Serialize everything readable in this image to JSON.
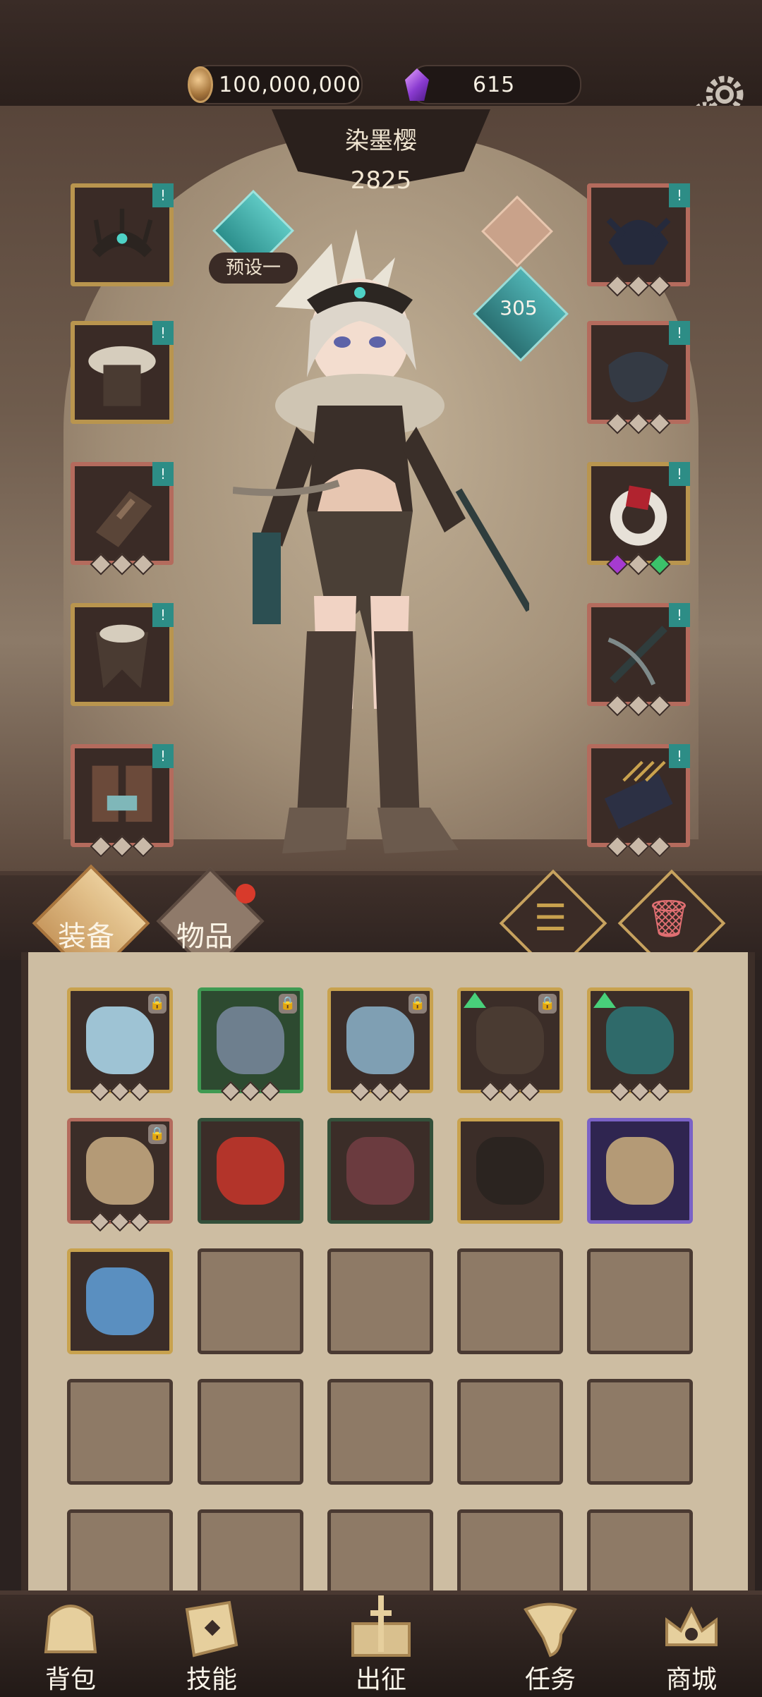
{
  "top": {
    "gold": "100,000,000",
    "gems": "615"
  },
  "hero": {
    "name": "染墨樱",
    "power": "2825",
    "preset_label": "预设一",
    "level": "305",
    "left_slots": [
      {
        "item": "crown",
        "frame": "gold",
        "tag": "!"
      },
      {
        "item": "fur-armor",
        "frame": "gold",
        "tag": "!"
      },
      {
        "item": "bracer",
        "frame": "red",
        "tag": "!"
      },
      {
        "item": "fur-skirt",
        "frame": "gold",
        "tag": "!"
      },
      {
        "item": "boots",
        "frame": "red",
        "tag": "!"
      }
    ],
    "right_slots": [
      {
        "item": "dark-helm",
        "frame": "red",
        "tag": "!"
      },
      {
        "item": "gauntlet",
        "frame": "red",
        "tag": "!"
      },
      {
        "item": "ring-ruby",
        "frame": "gold",
        "tag": "!"
      },
      {
        "item": "crossbow",
        "frame": "red",
        "tag": "!"
      },
      {
        "item": "quiver",
        "frame": "red",
        "tag": "!"
      }
    ]
  },
  "inventory": {
    "tabs": {
      "equip": "装备",
      "items": "物品"
    },
    "sort_glyph": "☰",
    "trash_glyph": "🗑",
    "items": [
      {
        "frame": "gold",
        "lock": true,
        "up": false,
        "art": "crossbow-ice"
      },
      {
        "frame": "green",
        "lock": true,
        "up": false,
        "art": "gauntlet-orb"
      },
      {
        "frame": "gold",
        "lock": true,
        "up": false,
        "art": "armor-ice"
      },
      {
        "frame": "gold",
        "lock": true,
        "up": true,
        "art": "skirt-spiked"
      },
      {
        "frame": "gold",
        "lock": false,
        "up": true,
        "art": "teal-pants"
      },
      {
        "frame": "red",
        "lock": true,
        "up": false,
        "art": "owl-amulet"
      },
      {
        "frame": "dgreen",
        "lock": false,
        "up": false,
        "art": "red-hood"
      },
      {
        "frame": "dgreen",
        "lock": false,
        "up": false,
        "art": "leather-boots"
      },
      {
        "frame": "gold",
        "lock": false,
        "up": false,
        "art": "crown"
      },
      {
        "frame": "purple",
        "lock": false,
        "up": false,
        "art": "owl-amulet"
      },
      {
        "frame": "gold",
        "lock": false,
        "up": false,
        "art": "eye-pendant"
      }
    ]
  },
  "nav": {
    "items": [
      {
        "label": "背包",
        "icon": "backpack-icon"
      },
      {
        "label": "技能",
        "icon": "skill-book-icon"
      },
      {
        "label": "出征",
        "icon": "sword-map-icon"
      },
      {
        "label": "任务",
        "icon": "scroll-icon"
      },
      {
        "label": "商城",
        "icon": "shop-crown-icon"
      }
    ]
  },
  "colors": {
    "accent_teal": "#2d8d86",
    "gold_frame": "#c8a24e",
    "red_frame": "#b46b5d",
    "parchment": "#cdbda2"
  }
}
